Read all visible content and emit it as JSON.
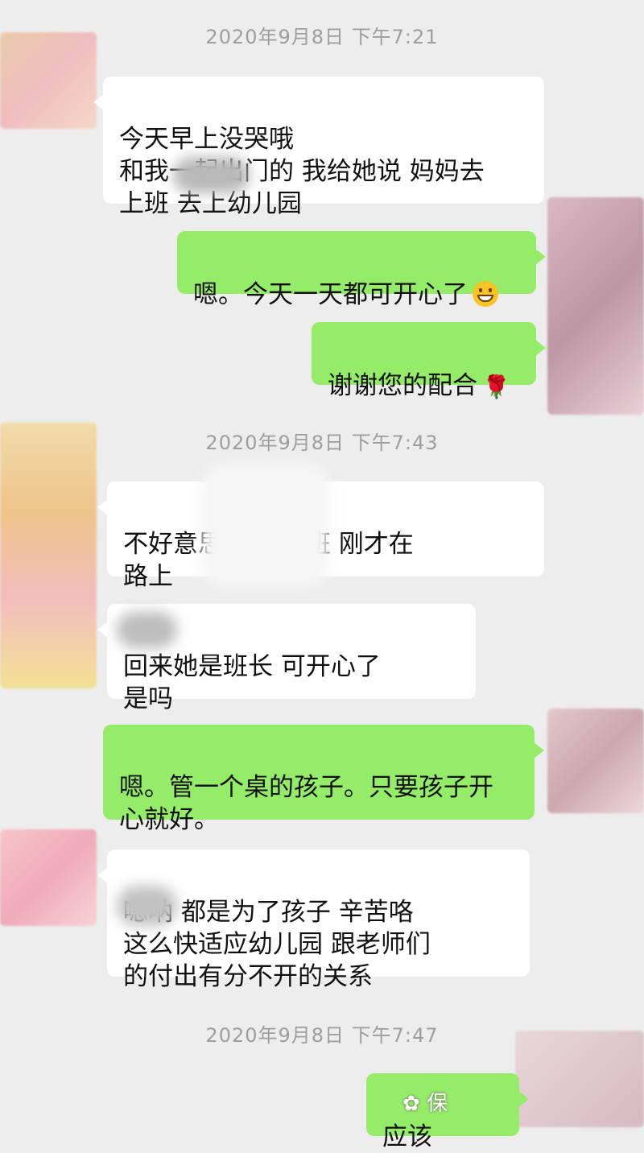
{
  "chat": {
    "timestamps": [
      "2020年9月8日 下午7:21",
      "2020年9月8日 下午7:43",
      "2020年9月8日 下午7:47"
    ],
    "messages": [
      {
        "side": "in",
        "text": "今天早上没哭哦\n和我一起出门的  我给她说  妈妈去\n上班        去上幼儿园"
      },
      {
        "side": "out",
        "text": "嗯。今天一天都可开心了",
        "emoji": "grin-icon"
      },
      {
        "side": "out",
        "text": "谢谢您的配合",
        "emoji": "rose-icon"
      },
      {
        "side": "in",
        "text": "不好意思            我刚下班  刚才在\n路上"
      },
      {
        "side": "in",
        "text": "     回来她是班长  可开心了\n是吗"
      },
      {
        "side": "out",
        "text": "嗯。管一个桌的孩子。只要孩子开\n心就好。"
      },
      {
        "side": "in",
        "text": "嗯呐   都是为了孩子  辛苦咯\n        这么快适应幼儿园  跟老师们\n的付出有分不开的关系"
      },
      {
        "side": "out",
        "text": "应该"
      }
    ]
  },
  "colors": {
    "background": "#ededed",
    "incoming_bubble": "#ffffff",
    "outgoing_bubble": "#95ec69",
    "timestamp_text": "#9e9e9e"
  },
  "watermark": {
    "text": "保"
  }
}
